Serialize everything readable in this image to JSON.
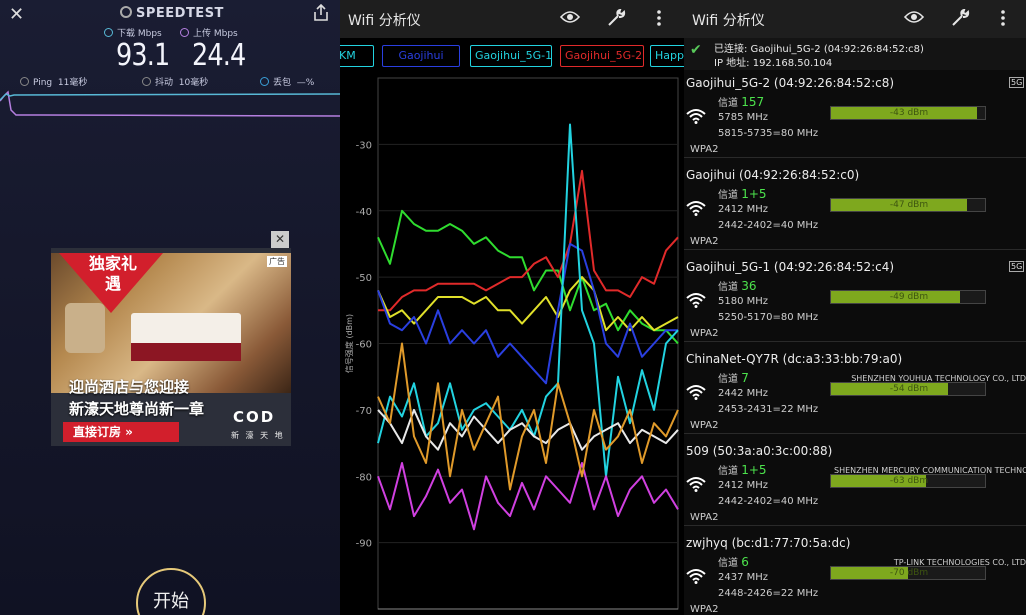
{
  "speedtest": {
    "brand": "SPEEDTEST",
    "download_label": "下载 Mbps",
    "upload_label": "上传 Mbps",
    "download_value": "93.1",
    "upload_value": "24.4",
    "ping_label": "Ping",
    "ping_value": "11毫秒",
    "jitter_label": "抖动",
    "jitter_value": "10毫秒",
    "loss_label": "丢包",
    "loss_value": "—%",
    "start_button": "开始",
    "colors": {
      "download": "#58b9d6",
      "upload": "#b57fe0"
    },
    "icons": [
      "close-icon",
      "share-icon",
      "speedtest-logo-icon",
      "ping-icon",
      "jitter-icon",
      "packet-loss-icon"
    ]
  },
  "ad": {
    "ribbon": "独家礼遇",
    "tag": "广告",
    "copy_line1": "迎尚酒店与您迎接",
    "copy_line2": "新濠天地尊尚新一章",
    "cta": "直接订房 »",
    "logo": "COD",
    "logo_sub": "新 濠 天 地",
    "close": "✕"
  },
  "analyzer": {
    "title": "Wifi 分析仪",
    "icons": [
      "eye-icon",
      "wrench-icon",
      "more-vert-icon"
    ],
    "tabs": [
      {
        "label": "KM",
        "color": "#22d3e0"
      },
      {
        "label": "Gaojihui",
        "color": "#2a3fe0"
      },
      {
        "label": "Gaojihui_5G-1",
        "color": "#22d3e0"
      },
      {
        "label": "Gaojihui_5G-2",
        "color": "#e02a2a"
      },
      {
        "label": "Happ",
        "color": "#22d3e0"
      }
    ]
  },
  "chart_data": {
    "type": "line",
    "ylabel": "信号强度 (dBm)",
    "yticks": [
      -30,
      -40,
      -50,
      -60,
      -70,
      -80,
      -90
    ],
    "ylim": [
      -100,
      -20
    ],
    "x": [
      0,
      1,
      2,
      3,
      4,
      5,
      6,
      7,
      8,
      9,
      10,
      11,
      12,
      13,
      14,
      15,
      16,
      17,
      18,
      19,
      20,
      21,
      22,
      23,
      24,
      25
    ],
    "series": [
      {
        "color": "#2fdc2f",
        "values": [
          -44,
          -48,
          -40,
          -42,
          -43,
          -43,
          -42,
          -43,
          -45,
          -44,
          -46,
          -47,
          -47,
          -52,
          -49,
          -49,
          -55,
          -50,
          -55,
          -54,
          -58,
          -55,
          -57,
          -58,
          -58,
          -60
        ]
      },
      {
        "color": "#e02a2a",
        "values": [
          -55,
          -55,
          -53,
          -52,
          -52,
          -51,
          -51,
          -51,
          -51,
          -52,
          -51,
          -50,
          -50,
          -48,
          -47,
          -50,
          -45,
          -34,
          -49,
          -52,
          -52,
          -53,
          -50,
          -51,
          -46,
          -44
        ]
      },
      {
        "color": "#e0e02a",
        "values": [
          -52,
          -56,
          -55,
          -57,
          -55,
          -53,
          -53,
          -53,
          -54,
          -53,
          -55,
          -55,
          -57,
          -55,
          -53,
          -56,
          -52,
          -50,
          -52,
          -58,
          -56,
          -58,
          -56,
          -58,
          -57,
          -56
        ]
      },
      {
        "color": "#2a3fe0",
        "values": [
          -52,
          -57,
          -58,
          -56,
          -60,
          -55,
          -60,
          -58,
          -60,
          -58,
          -62,
          -60,
          -62,
          -64,
          -66,
          -55,
          -45,
          -46,
          -52,
          -60,
          -62,
          -57,
          -62,
          -60,
          -58,
          -58
        ]
      },
      {
        "color": "#22d3e0",
        "values": [
          -75,
          -68,
          -71,
          -66,
          -74,
          -72,
          -66,
          -73,
          -70,
          -69,
          -71,
          -73,
          -70,
          -74,
          -68,
          -66,
          -27,
          -55,
          -60,
          -80,
          -65,
          -72,
          -64,
          -70,
          -60,
          -58
        ]
      },
      {
        "color": "#d040e0",
        "values": [
          -80,
          -85,
          -78,
          -86,
          -83,
          -79,
          -84,
          -82,
          -88,
          -80,
          -84,
          -86,
          -81,
          -85,
          -80,
          -82,
          -84,
          -78,
          -85,
          -80,
          -86,
          -82,
          -80,
          -84,
          -82,
          -85
        ]
      },
      {
        "color": "#e8e8e8",
        "values": [
          -70,
          -72,
          -75,
          -70,
          -74,
          -76,
          -72,
          -74,
          -71,
          -73,
          -75,
          -73,
          -72,
          -74,
          -75,
          -73,
          -72,
          -76,
          -74,
          -73,
          -72,
          -75,
          -73,
          -74,
          -75,
          -73
        ]
      },
      {
        "color": "#e09a2a",
        "values": [
          -68,
          -72,
          -60,
          -74,
          -78,
          -66,
          -80,
          -70,
          -76,
          -72,
          -68,
          -82,
          -74,
          -70,
          -78,
          -66,
          -72,
          -80,
          -70,
          -76,
          -74,
          -70,
          -78,
          -72,
          -74,
          -70
        ]
      }
    ],
    "grid": true
  },
  "wifi_list": {
    "title": "Wifi 分析仪",
    "connected_line1": "已连接: Gaojihui_5G-2 (04:92:26:84:52:c8)",
    "connected_line2": "IP 地址: 192.168.50.104",
    "channel_label": "信道",
    "networks": [
      {
        "name": "Gaojihui_5G-2 (04:92:26:84:52:c8)",
        "band": "5G",
        "channel": "157",
        "freq": "5785 MHz",
        "range": "5815-5735=80 MHz",
        "security": "WPA2",
        "vendor": "",
        "signal": "-43 dBm",
        "strength": 0.95
      },
      {
        "name": "Gaojihui (04:92:26:84:52:c0)",
        "band": "",
        "channel": "1+5",
        "freq": "2412 MHz",
        "range": "2442-2402=40 MHz",
        "security": "WPA2",
        "vendor": "",
        "signal": "-47 dBm",
        "strength": 0.88
      },
      {
        "name": "Gaojihui_5G-1 (04:92:26:84:52:c4)",
        "band": "5G",
        "channel": "36",
        "freq": "5180 MHz",
        "range": "5250-5170=80 MHz",
        "security": "WPA2",
        "vendor": "",
        "signal": "-49 dBm",
        "strength": 0.84
      },
      {
        "name": "ChinaNet-QY7R (dc:a3:33:bb:79:a0)",
        "band": "",
        "channel": "7",
        "freq": "2442 MHz",
        "range": "2453-2431=22 MHz",
        "security": "WPA2",
        "vendor": "SHENZHEN YOUHUA TECHNOLOGY CO., LTD",
        "signal": "-54 dBm",
        "strength": 0.76
      },
      {
        "name": "509 (50:3a:a0:3c:00:88)",
        "band": "",
        "channel": "1+5",
        "freq": "2412 MHz",
        "range": "2442-2402=40 MHz",
        "security": "WPA2",
        "vendor": "SHENZHEN MERCURY COMMUNICATION TECHNOLOGIES",
        "signal": "-63 dBm",
        "strength": 0.62
      },
      {
        "name": "zwjhyq (bc:d1:77:70:5a:dc)",
        "band": "",
        "channel": "6",
        "freq": "2437 MHz",
        "range": "2448-2426=22 MHz",
        "security": "WPA2",
        "vendor": "TP-LINK TECHNOLOGIES CO., LTD",
        "signal": "-70 dBm",
        "strength": 0.5
      }
    ]
  }
}
